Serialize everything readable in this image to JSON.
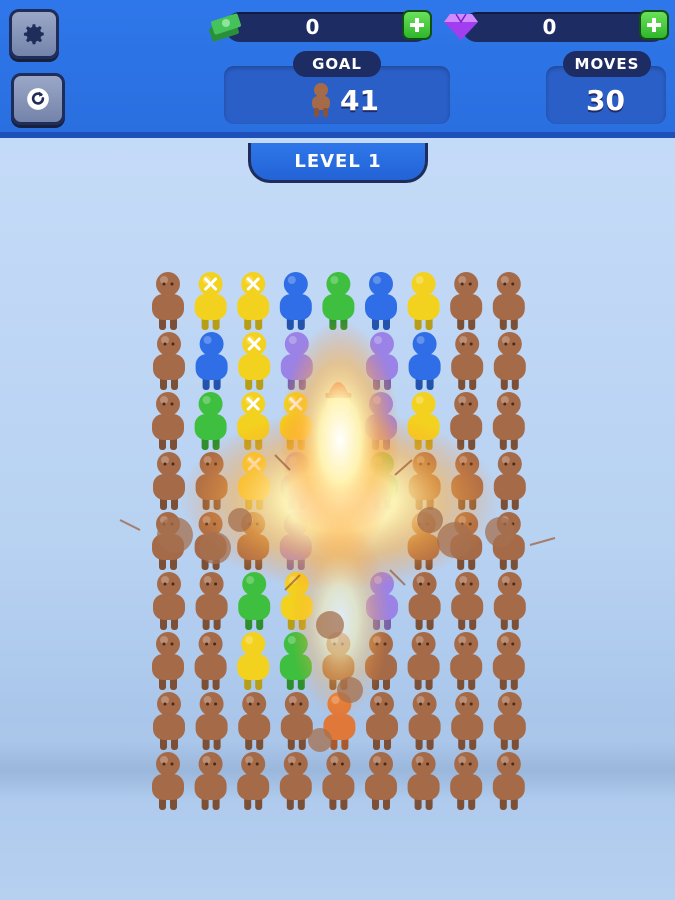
{
  "hud": {
    "settings_icon": "gear-icon",
    "restart_icon": "restart-icon",
    "cash": {
      "icon": "cash-stack-icon",
      "value": "0"
    },
    "gems": {
      "icon": "gem-icon",
      "value": "0"
    },
    "goal": {
      "label": "GOAL",
      "icon": "figure-icon",
      "value": "41"
    },
    "moves": {
      "label": "MOVES",
      "value": "30"
    }
  },
  "level": {
    "label": "LEVEL 1"
  },
  "colors": {
    "brown": "#a56a48",
    "yellow": "#f3d21f",
    "blue": "#2f6ee6",
    "green": "#3fbf3f",
    "purple": "#9b82e6",
    "white": "#ffffff",
    "hat_red": "#d81f1f",
    "explosion": "#fff3b0"
  },
  "grid": {
    "columns": 9,
    "rows": [
      [
        "brown",
        "yellow-x",
        "yellow-x",
        "blue",
        "green",
        "blue",
        "yellow",
        "brown",
        "brown"
      ],
      [
        "brown",
        "blue",
        "yellow-x",
        "purple",
        "empty",
        "purple",
        "blue",
        "brown",
        "brown"
      ],
      [
        "brown",
        "green",
        "yellow-x",
        "yellow-x",
        "white-hat",
        "purple",
        "yellow",
        "brown",
        "brown"
      ],
      [
        "brown",
        "brown",
        "yellow-x",
        "purple",
        "empty",
        "green",
        "brown",
        "brown",
        "brown"
      ],
      [
        "brown",
        "brown",
        "brown",
        "purple",
        "empty",
        "empty",
        "brown",
        "brown",
        "brown"
      ],
      [
        "brown",
        "brown",
        "green",
        "yellow",
        "empty",
        "purple",
        "brown",
        "brown",
        "brown"
      ],
      [
        "brown",
        "brown",
        "yellow",
        "green",
        "brown",
        "brown",
        "brown",
        "brown",
        "brown"
      ],
      [
        "brown",
        "brown",
        "brown",
        "brown",
        "orange",
        "brown",
        "brown",
        "brown",
        "brown"
      ],
      [
        "brown",
        "brown",
        "brown",
        "brown",
        "brown",
        "brown",
        "brown",
        "brown",
        "brown"
      ]
    ]
  }
}
